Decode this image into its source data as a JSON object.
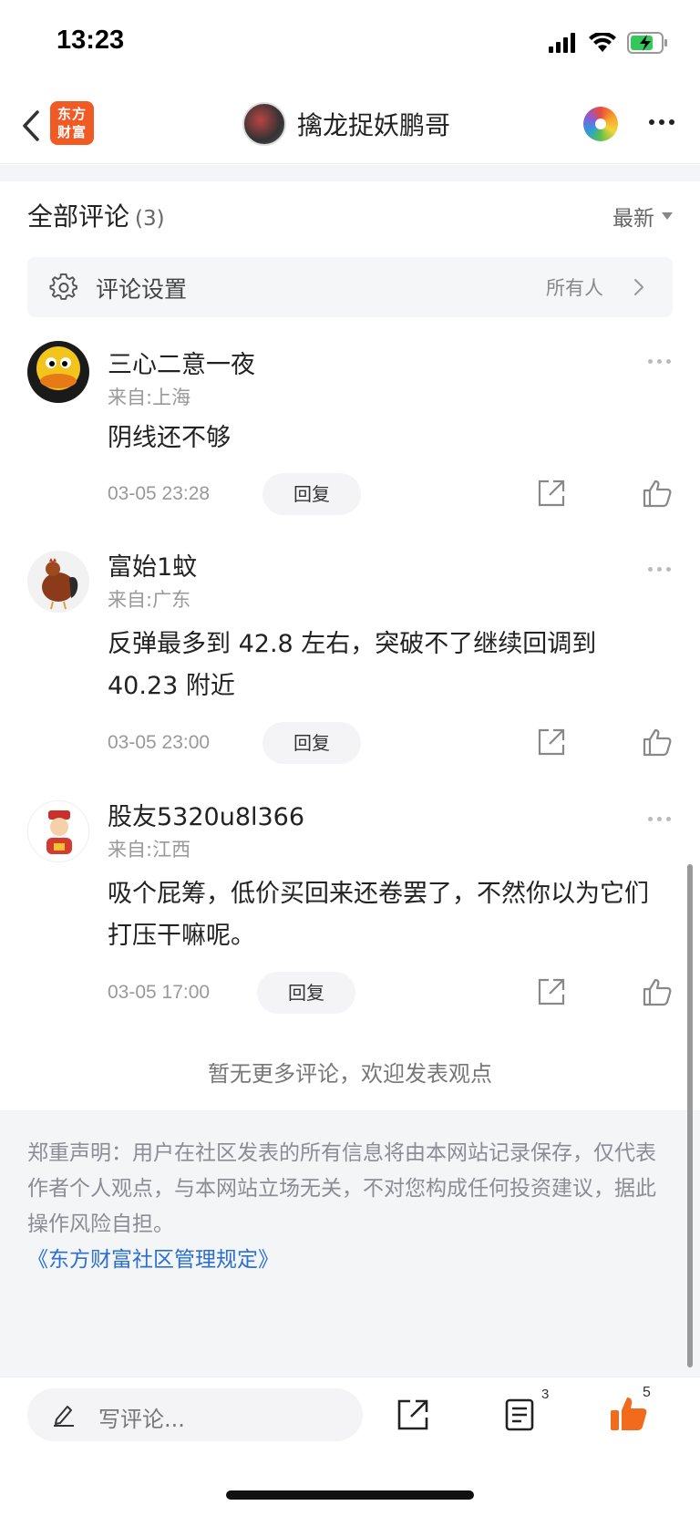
{
  "status_bar": {
    "time": "13:23"
  },
  "nav": {
    "logo_text_line1": "东方",
    "logo_text_line2": "财富",
    "title": "擒龙捉妖鹏哥"
  },
  "comments_header": {
    "title": "全部评论",
    "count": "(3)",
    "sort_label": "最新"
  },
  "settings": {
    "label": "评论设置",
    "value": "所有人"
  },
  "comments": [
    {
      "name": "三心二意一夜",
      "location": "来自:上海",
      "text": "阴线还不够",
      "time": "03-05 23:28",
      "reply_label": "回复"
    },
    {
      "name": "富始1蚊",
      "location": "来自:广东",
      "text": "反弹最多到 42.8 左右，突破不了继续回调到 40.23 附近",
      "time": "03-05 23:00",
      "reply_label": "回复"
    },
    {
      "name": "股友5320u8l366",
      "location": "来自:江西",
      "text": "吸个屁筹，低价买回来还卷罢了，不然你以为它们打压干嘛呢。",
      "time": "03-05 17:00",
      "reply_label": "回复"
    }
  ],
  "no_more_text": "暂无更多评论，欢迎发表观点",
  "disclaimer": {
    "text": "郑重声明：用户在社区发表的所有信息将由本网站记录保存，仅代表作者个人观点，与本网站立场无关，不对您构成任何投资建议，据此操作风险自担。",
    "link": "《东方财富社区管理规定》"
  },
  "bottom_bar": {
    "write_placeholder": "写评论...",
    "comment_count": "3",
    "like_count": "5"
  },
  "colors": {
    "brand_orange": "#f05a24",
    "link_blue": "#2a6fd1",
    "like_orange": "#f26b1d",
    "battery_green": "#34c759"
  }
}
